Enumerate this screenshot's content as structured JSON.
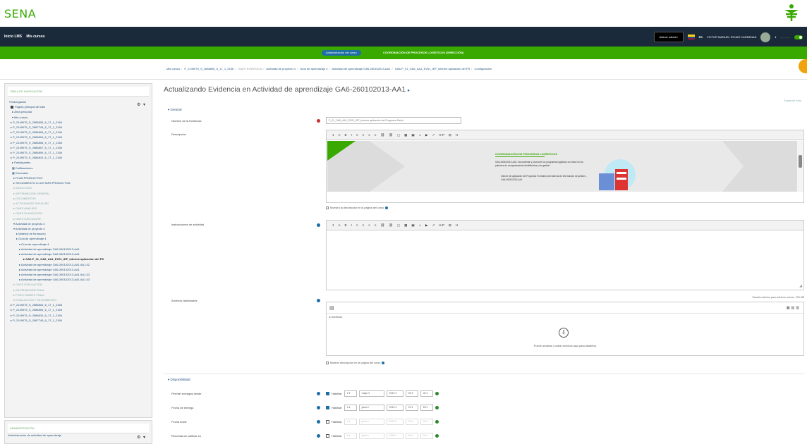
{
  "brand": {
    "logo_text": "SENA",
    "accent": "#39a900",
    "dark": "#1b2a3a"
  },
  "topnav": {
    "left_items": [
      "Inicio LMS",
      "Mis cursos"
    ],
    "edit_button": "Activar edición",
    "language": "ES",
    "user_name": "VICTOR MANUEL ROJAS CARDENAS"
  },
  "greenbar": {
    "pill": "Administración del curso",
    "coordination": "COORDINACIÓN DE PROCESOS LOGÍSTICOS (DIRECCIÓN)"
  },
  "breadcrumb": [
    "Mis cursos",
    "P_2149075_S_2686805_6_17_1_2166",
    "GAES EVIDENCIA",
    "Actividad de proyecto 4",
    "Guía de aprendizaje 4",
    "Actividad de aprendizaje GA6-260102013-AA1",
    "GA6-P_01_GA6_AA1_EV01_IEF_informe aplicación del PS",
    "Configuración"
  ],
  "sidebar": {
    "block1_title": "TABLA DE NAVEGACIÓN",
    "tree": [
      {
        "t": "Navegación",
        "c": "top"
      },
      {
        "t": "Página principal del sitio",
        "c": "b"
      },
      {
        "t": "Área personal",
        "c": ""
      },
      {
        "t": "Mis cursos",
        "c": ""
      },
      {
        "t": "P_2149075_S_2686805_6_17_1_2166",
        "c": ""
      },
      {
        "t": "P_2149075_S_2687745_6_17_1_2166",
        "c": ""
      },
      {
        "t": "P_2149075_S_2686806_6_17_1_2166",
        "c": ""
      },
      {
        "t": "P_2149075_S_2686804_6_17_1_2166",
        "c": ""
      },
      {
        "t": "P_2149075_S_2686808_6_17_1_2166",
        "c": ""
      },
      {
        "t": "P_2149075_S_2686807_6_17_1_2166",
        "c": ""
      },
      {
        "t": "P_2149075_S_2686809_6_17_1_2166",
        "c": ""
      },
      {
        "t": "P_2149075_S_2686810_6_17_1_2166",
        "c": ""
      },
      {
        "t": "Participantes",
        "c": ""
      },
      {
        "t": "Calificaciones",
        "c": "sq"
      },
      {
        "t": "Generales",
        "c": "sq"
      },
      {
        "t": "PLAN PRODUCTIVO",
        "c": ""
      },
      {
        "t": "SEGUIMIENTO A LA ETAPA PRODUCTIVA",
        "c": ""
      },
      {
        "t": "INDUCCIÓN",
        "c": "dim"
      },
      {
        "t": "INFORMACIÓN GENERAL",
        "c": "dim"
      },
      {
        "t": "DOCUMENTOS",
        "c": "dim"
      },
      {
        "t": "ACTIVIDADES INICIALES",
        "c": "dim"
      },
      {
        "t": "GAES ANÁLISIS",
        "c": "dim"
      },
      {
        "t": "GAES PLANEACIÓN",
        "c": "dim"
      },
      {
        "t": "GAES EJECUCIÓN",
        "c": "dim"
      },
      {
        "t": "Actividad de proyecto 3",
        "c": ""
      },
      {
        "t": "Actividad de proyecto 4",
        "c": ""
      },
      {
        "t": "Material de formación",
        "c": "i1"
      },
      {
        "t": "Guía de aprendizaje 4",
        "c": "i1"
      },
      {
        "t": "Guía de aprendizaje 4",
        "c": "i2"
      },
      {
        "t": "Actividad de aprendizaje GA6-260102013-AA1",
        "c": "i2"
      },
      {
        "t": "Actividad de aprendizaje GA6-260102013-AA1",
        "c": "i2"
      },
      {
        "t": "GA6-P_01_GA6_AA1_EV01_IEF_informe aplicación del PS",
        "c": "i3"
      },
      {
        "t": "Actividad de aprendizaje GA6-260102013-AA1 AA1-02",
        "c": "i2"
      },
      {
        "t": "Actividad de aprendizaje GA6-260102013-AA1",
        "c": "i2"
      },
      {
        "t": "Actividad de aprendizaje GA6-260102013-AA1 AA1-02",
        "c": "i2"
      },
      {
        "t": "Actividad de aprendizaje GA6-260102013-AA1 AA1-03",
        "c": "i2"
      },
      {
        "t": "GAES EVALUACIÓN",
        "c": "dim"
      },
      {
        "t": "INFORMACIÓN FINAL",
        "c": "dim"
      },
      {
        "t": "FORO DEBATE FINAL",
        "c": "dim"
      },
      {
        "t": "EVALUACIÓN Y SEGUIMIENTO",
        "c": "dim"
      },
      {
        "t": "P_2149075_S_2686804_6_17_1_2166",
        "c": ""
      },
      {
        "t": "P_2149075_S_2686806_6_17_1_2166",
        "c": ""
      },
      {
        "t": "P_2149075_S_2686810_6_17_1_2166",
        "c": ""
      },
      {
        "t": "P_2149075_S_2687745_6_17_1_2166",
        "c": ""
      }
    ],
    "block2_title": "ADMINISTRACIÓN",
    "block2_item": "Administración de actividad de aprendizaje"
  },
  "main": {
    "title": "Actualizando Evidencia en Actividad de aprendizaje GA6-260102013-AA1",
    "expand_all": "Expandir todo",
    "general_label": "General",
    "name_label": "Nombre de la Evidencia",
    "name_value": "P_01_GA6_AA1_EV01_IEF_informe aplicación del Programa Salud",
    "description_label": "Descripción",
    "toolbar": [
      "1",
      "A",
      "B",
      "I",
      "≡",
      "≡",
      "≡",
      "≡",
      "⛓",
      "⛓",
      "▢",
      "▦",
      "▣",
      "♫",
      "▶",
      "↗",
      "H-P",
      "⊞",
      "H"
    ],
    "show_desc": "Muestra la descripción en la página del curso",
    "activity_label": "Instrucciones de actividad",
    "files_label": "Archivos adicionales",
    "max_size": "Tamaño máximo para archivos nuevos: 200 MB",
    "files_crumb": "Archivos",
    "drop_hint": "Puede arrastrar y soltar archivos aquí para añadirlos",
    "show_files": "Mostrar descripción en la página del curso",
    "availability_label": "Disponibilidad",
    "date_rows": [
      {
        "label": "Permitir entregas desde",
        "enable": "Habilitar",
        "on": true,
        "d": "2",
        "m": "mayo",
        "y": "2019",
        "h": "00",
        "mi": "00"
      },
      {
        "label": "Fecha de entrega",
        "enable": "Habilitar",
        "on": true,
        "d": "4",
        "m": "junio",
        "y": "2019",
        "h": "23",
        "mi": "59"
      },
      {
        "label": "Fecha límite",
        "enable": "Habilitar",
        "on": false,
        "d": "2",
        "m": "junio",
        "y": "2019",
        "h": "00",
        "mi": "00"
      },
      {
        "label": "Recordarme calificar en",
        "enable": "Habilitar",
        "on": false,
        "d": "2",
        "m": "junio",
        "y": "2019",
        "h": "00",
        "mi": "00"
      }
    ],
    "banner": {
      "heading": "COORDINACIÓN DE PROCESOS LOGÍSTICOS",
      "code": "GA6-260102013-AA1: Documentar y promover los programas logísticos con base en los patrones de comportamiento identificados y de gestión.",
      "bullet": "Informe de aplicación del Programa Formativo del sistema de información de gestión - GA6-260102013-AA1"
    }
  }
}
